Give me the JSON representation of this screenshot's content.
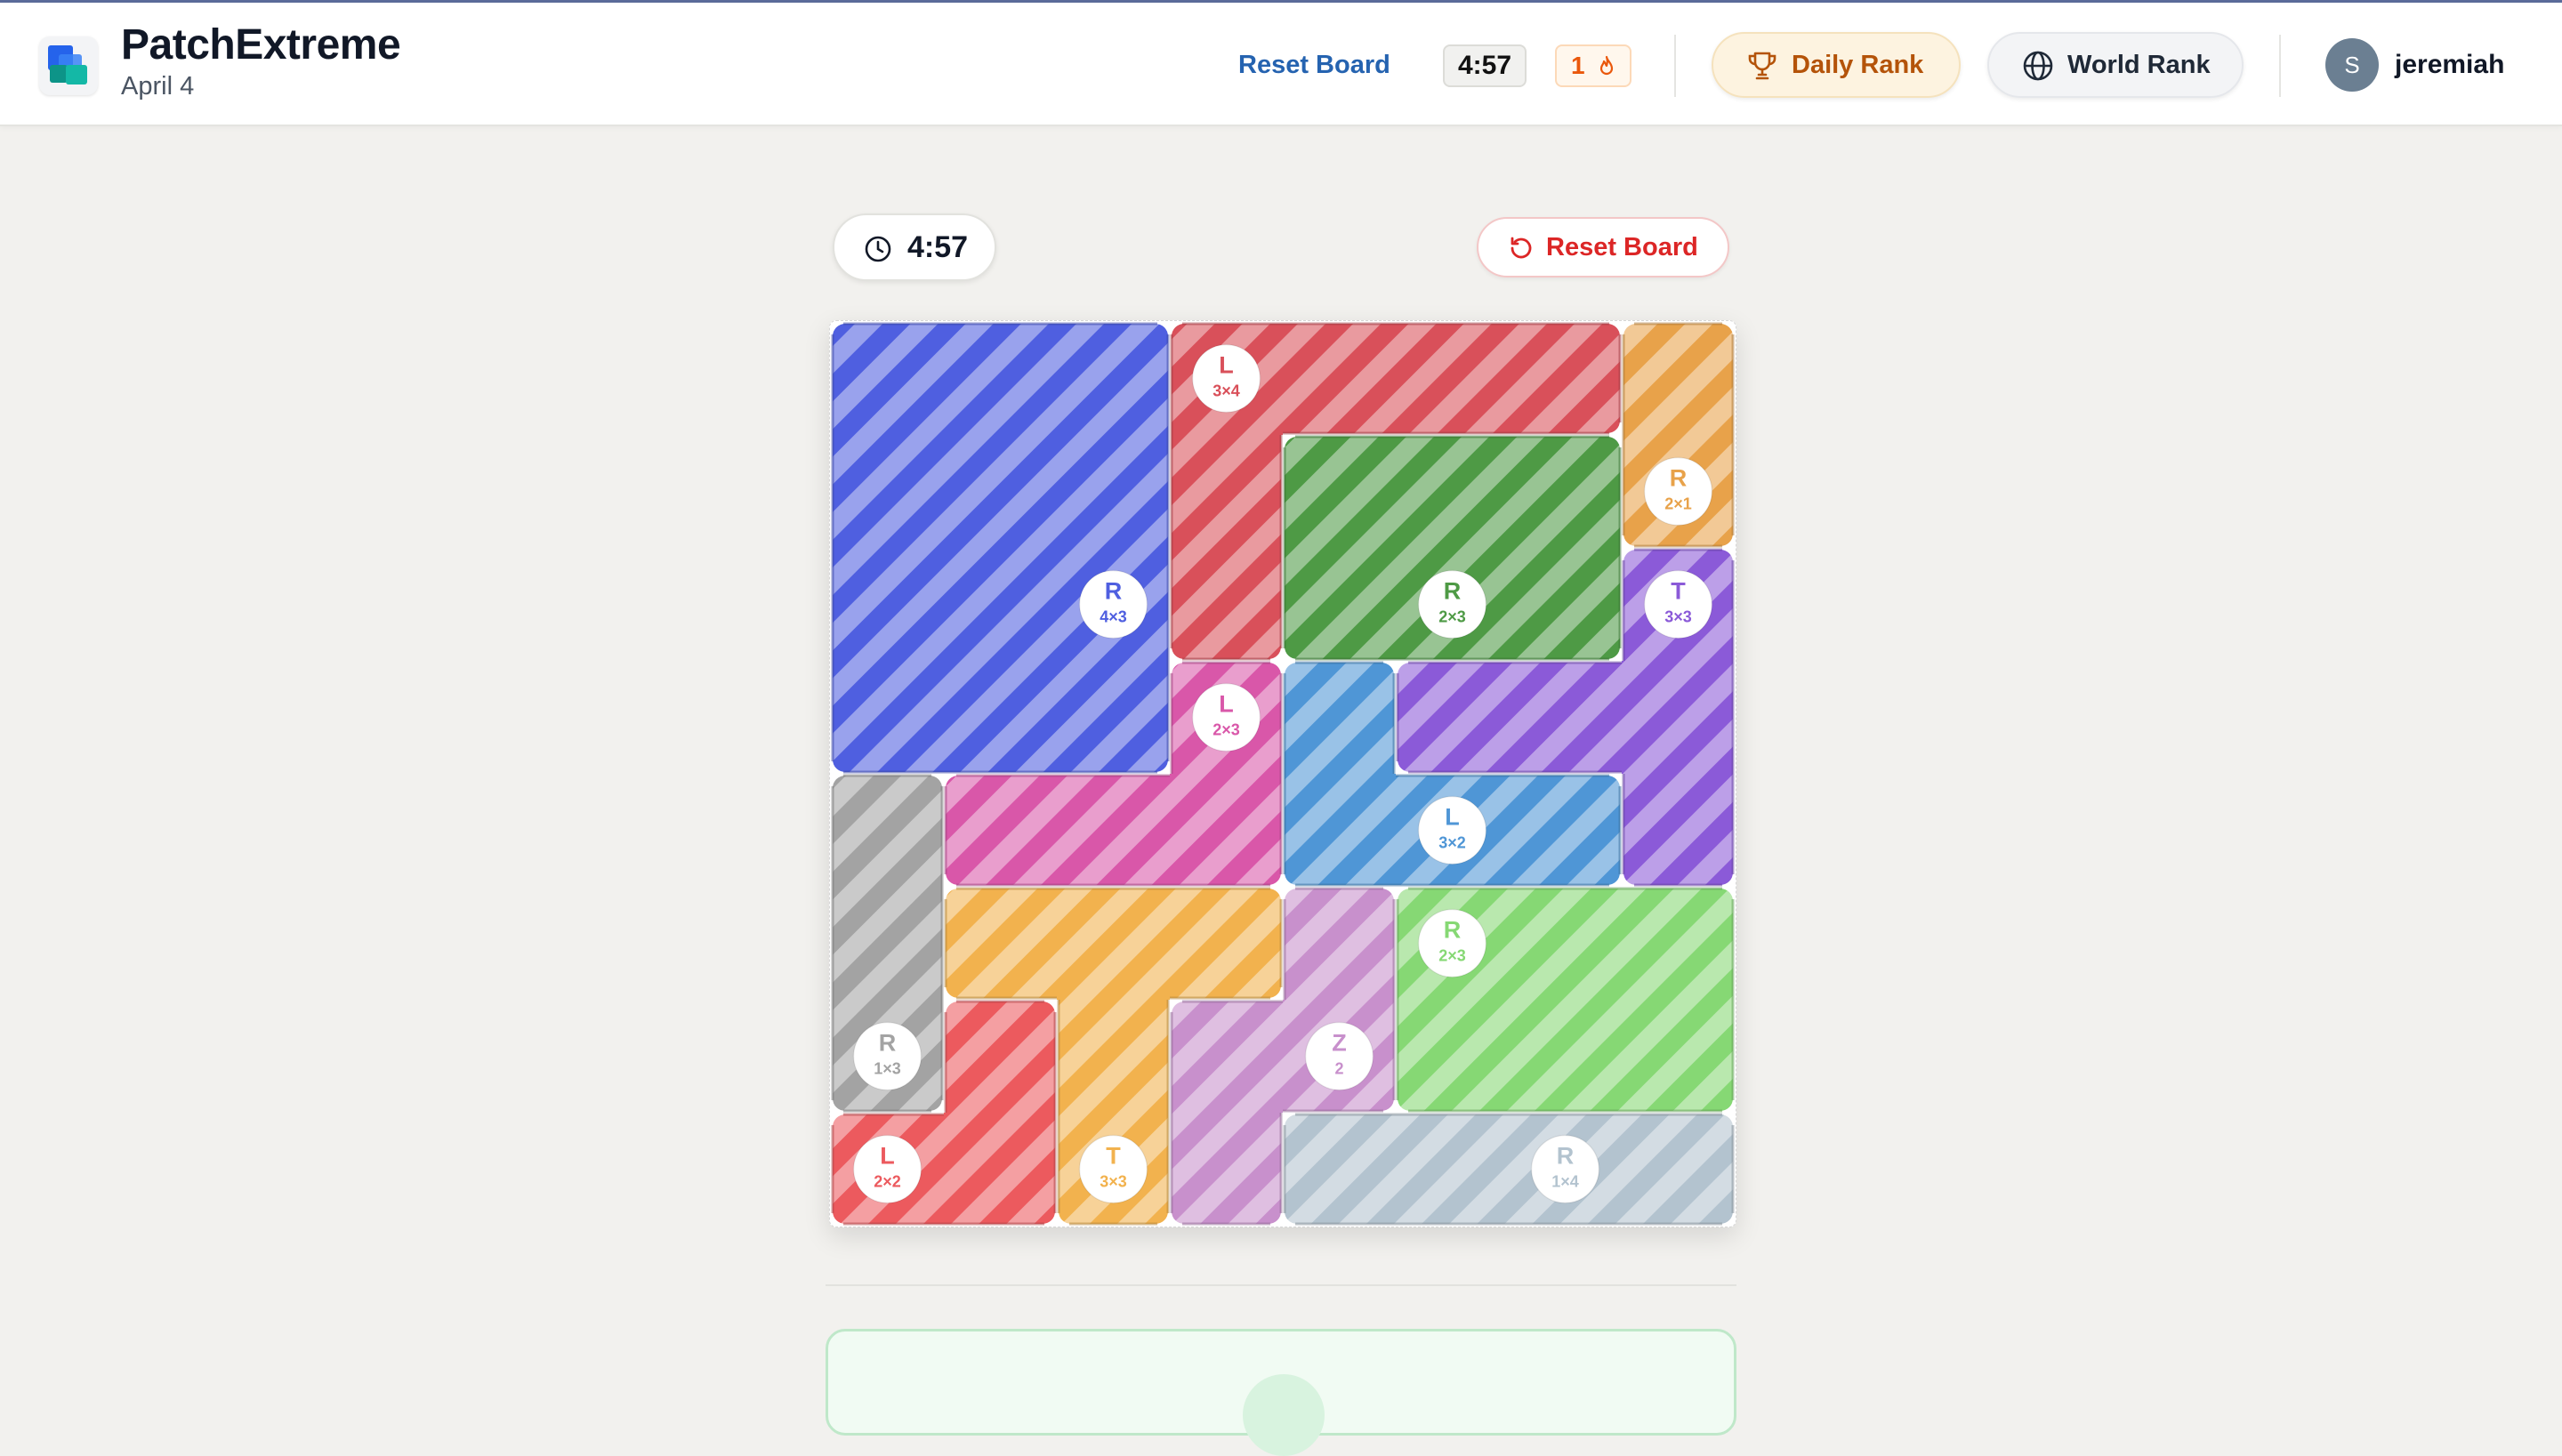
{
  "app": {
    "title": "PatchExtreme",
    "date": "April 4"
  },
  "header": {
    "reset_label": "Reset Board",
    "timer": "4:57",
    "streak": "1",
    "daily_rank_label": "Daily Rank",
    "world_rank_label": "World Rank",
    "user": {
      "initial": "S",
      "name": "jeremiah"
    }
  },
  "game": {
    "timer": "4:57",
    "reset_label": "Reset Board",
    "grid_size": 8,
    "pieces": [
      {
        "shape": "R",
        "size": "4×3",
        "color": "#4f5fe0",
        "cells": [
          [
            0,
            0
          ],
          [
            0,
            1
          ],
          [
            0,
            2
          ],
          [
            1,
            0
          ],
          [
            1,
            1
          ],
          [
            1,
            2
          ],
          [
            2,
            0
          ],
          [
            2,
            1
          ],
          [
            2,
            2
          ],
          [
            3,
            0
          ],
          [
            3,
            1
          ],
          [
            3,
            2
          ]
        ],
        "badge": [
          2,
          2
        ]
      },
      {
        "shape": "L",
        "size": "3×4",
        "color": "#d9505a",
        "cells": [
          [
            0,
            3
          ],
          [
            0,
            4
          ],
          [
            0,
            5
          ],
          [
            0,
            6
          ],
          [
            1,
            3
          ],
          [
            2,
            3
          ]
        ],
        "badge": [
          0,
          3
        ]
      },
      {
        "shape": "R",
        "size": "2×1",
        "color": "#e8a24a",
        "cells": [
          [
            0,
            7
          ],
          [
            1,
            7
          ]
        ],
        "badge": [
          1,
          7
        ]
      },
      {
        "shape": "R",
        "size": "2×3",
        "color": "#4e9a45",
        "cells": [
          [
            1,
            4
          ],
          [
            1,
            5
          ],
          [
            1,
            6
          ],
          [
            2,
            4
          ],
          [
            2,
            5
          ],
          [
            2,
            6
          ]
        ],
        "badge": [
          2,
          5
        ]
      },
      {
        "shape": "T",
        "size": "3×3",
        "color": "#8b5ad8",
        "cells": [
          [
            2,
            7
          ],
          [
            3,
            5
          ],
          [
            3,
            6
          ],
          [
            3,
            7
          ],
          [
            4,
            7
          ]
        ],
        "badge": [
          2,
          7
        ]
      },
      {
        "shape": "L",
        "size": "2×3",
        "color": "#d957a9",
        "cells": [
          [
            3,
            3
          ],
          [
            4,
            1
          ],
          [
            4,
            2
          ],
          [
            4,
            3
          ]
        ],
        "badge": [
          3,
          3
        ]
      },
      {
        "shape": "L",
        "size": "3×2",
        "color": "#4f96d6",
        "cells": [
          [
            3,
            4
          ],
          [
            4,
            4
          ],
          [
            4,
            5
          ],
          [
            4,
            6
          ]
        ],
        "badge": [
          4,
          5
        ]
      },
      {
        "shape": "R",
        "size": "1×3",
        "color": "#a3a3a3",
        "cells": [
          [
            4,
            0
          ],
          [
            5,
            0
          ],
          [
            6,
            0
          ]
        ],
        "badge": [
          6,
          0
        ]
      },
      {
        "shape": "T",
        "size": "3×3",
        "color": "#f2b24e",
        "cells": [
          [
            5,
            1
          ],
          [
            5,
            2
          ],
          [
            5,
            3
          ],
          [
            6,
            2
          ],
          [
            7,
            2
          ]
        ],
        "badge": [
          7,
          2
        ]
      },
      {
        "shape": "Z",
        "size": "2",
        "color": "#c890cc",
        "cells": [
          [
            5,
            4
          ],
          [
            6,
            3
          ],
          [
            6,
            4
          ],
          [
            7,
            3
          ]
        ],
        "badge": [
          6,
          4
        ]
      },
      {
        "shape": "R",
        "size": "2×3",
        "color": "#86d874",
        "cells": [
          [
            5,
            5
          ],
          [
            5,
            6
          ],
          [
            5,
            7
          ],
          [
            6,
            5
          ],
          [
            6,
            6
          ],
          [
            6,
            7
          ]
        ],
        "badge": [
          5,
          5
        ]
      },
      {
        "shape": "L",
        "size": "2×2",
        "color": "#ec5a5e",
        "cells": [
          [
            6,
            1
          ],
          [
            7,
            0
          ],
          [
            7,
            1
          ]
        ],
        "badge": [
          7,
          0
        ]
      },
      {
        "shape": "R",
        "size": "1×4",
        "color": "#b3c3cf",
        "cells": [
          [
            7,
            4
          ],
          [
            7,
            5
          ],
          [
            7,
            6
          ],
          [
            7,
            7
          ]
        ],
        "badge": [
          7,
          6
        ]
      }
    ]
  }
}
